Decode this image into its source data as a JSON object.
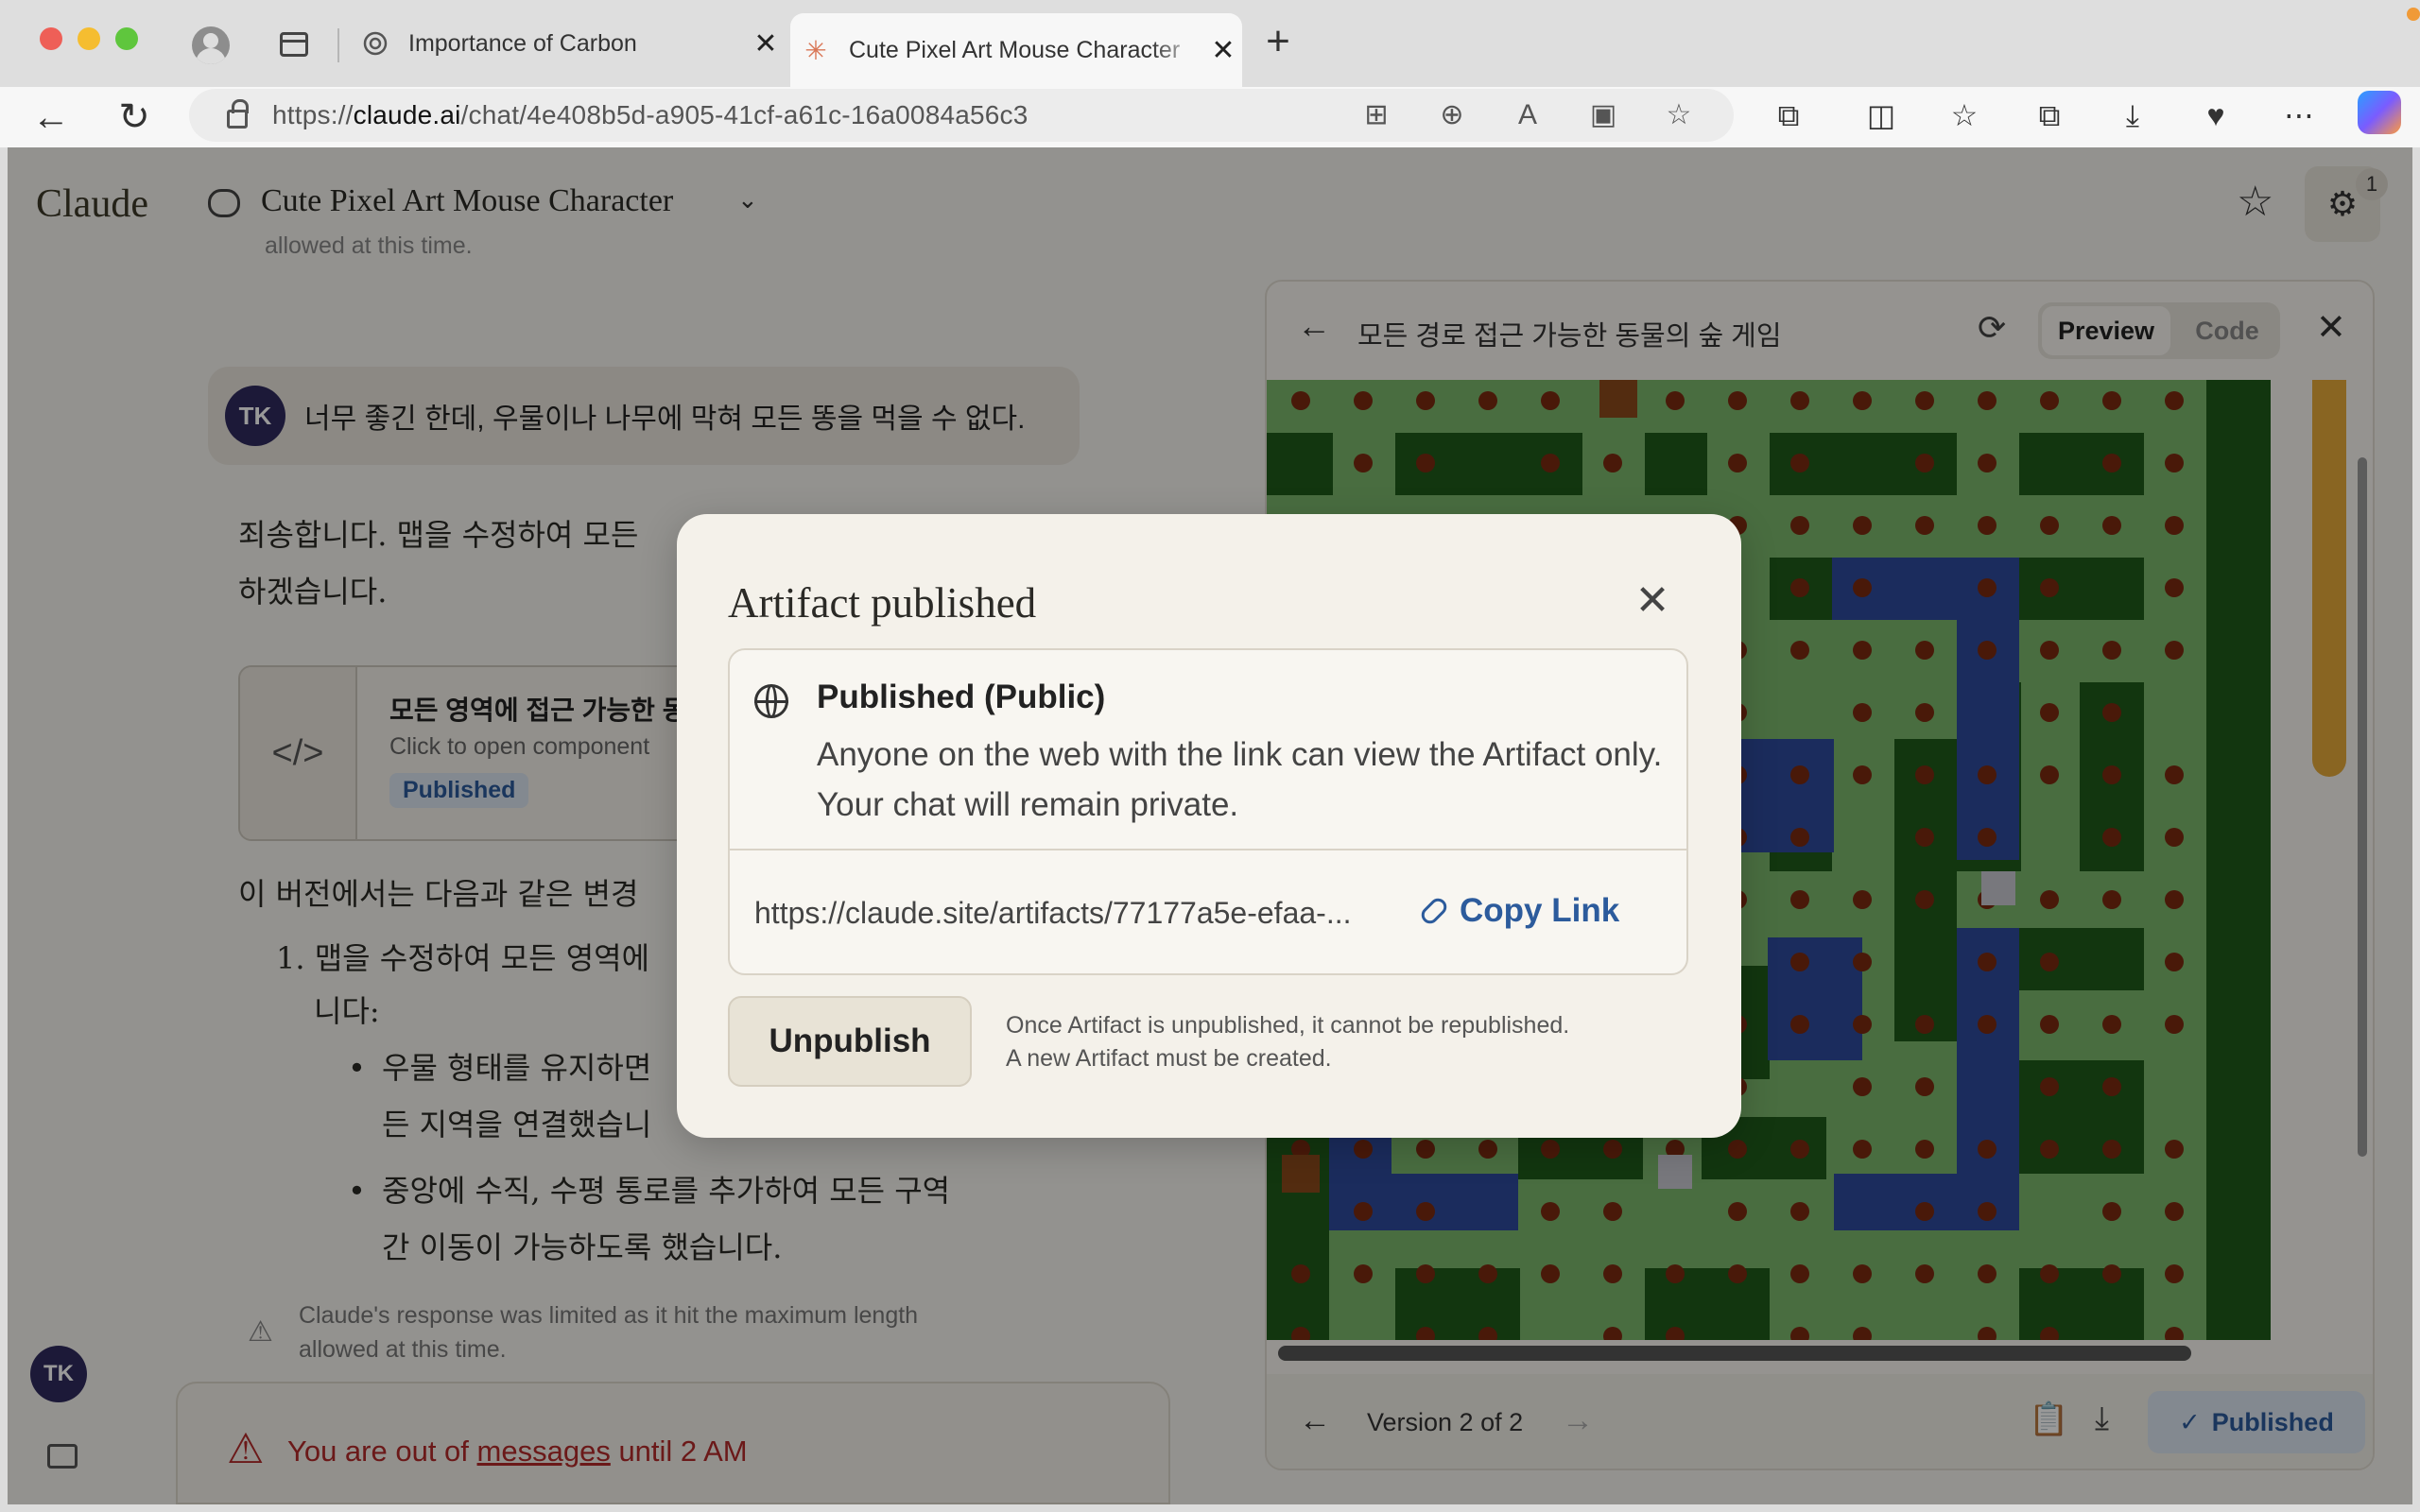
{
  "browser": {
    "tabs": [
      {
        "title": "Importance of Carbon",
        "favicon": "openai-icon",
        "active": false
      },
      {
        "title": "Cute Pixel Art Mouse Character",
        "favicon": "claude-icon",
        "active": true
      }
    ],
    "url_prefix": "https://",
    "url_domain": "claude.ai",
    "url_path": "/chat/4e408b5d-a905-41cf-a61c-16a0084a56c3"
  },
  "app": {
    "logo": "Claude",
    "chat_title": "Cute Pixel Art Mouse Character",
    "settings_badge": "1",
    "faded_warning": "allowed at this time.",
    "user_avatar": "TK",
    "user_message": "너무 좋긴 한데, 우물이나 나무에 막혀 모든 똥을 먹을 수 없다.",
    "ai_intro_line1": "죄송합니다. 맵을 수정하여 모든",
    "ai_intro_line2": "하겠습니다.",
    "artifact_card": {
      "title": "모든 영역에 접근 가능한 동물의 숲 게임",
      "subtitle": "Click to open component",
      "badge": "Published"
    },
    "changes_intro": "이 버전에서는 다음과 같은 변경",
    "list_item_1a": "1. 맵을 수정하여 모든 영역에",
    "list_item_1b": "니다:",
    "bullet_1a": "우물 형태를 유지하면",
    "bullet_1b": "든 지역을 연결했습니",
    "bullet_2a": "중앙에 수직, 수평 통로를 추가하여 모든 구역",
    "bullet_2b": "간 이동이 가능하도록 했습니다.",
    "limit_line1": "Claude's response was limited as it hit the maximum length",
    "limit_line2": "allowed at this time.",
    "out_prefix": "You are out of ",
    "out_link": "messages",
    "out_suffix": " until 2 AM",
    "sidebar_avatar": "TK"
  },
  "panel": {
    "title": "모든 경로 접근 가능한 동물의 숲 게임",
    "preview_label": "Preview",
    "code_label": "Code",
    "version_label": "Version 2 of 2",
    "published_label": "Published"
  },
  "modal": {
    "title": "Artifact published",
    "heading": "Published (Public)",
    "description": "Anyone on the web with the link can view the Artifact only. Your chat will remain private.",
    "link": "https://claude.site/artifacts/77177a5e-efaa-...",
    "copy_label": "Copy Link",
    "unpublish_label": "Unpublish",
    "note_line1": "Once Artifact is unpublished, it cannot be republished.",
    "note_line2": "A new Artifact must be created."
  },
  "colors": {
    "accent_blue": "#2c5b9c",
    "error_red": "#b22b2b",
    "grass": "#7bb66c",
    "dark_grass": "#1f5a1a",
    "water": "#2e4a9c",
    "dot": "#7a2a10"
  }
}
